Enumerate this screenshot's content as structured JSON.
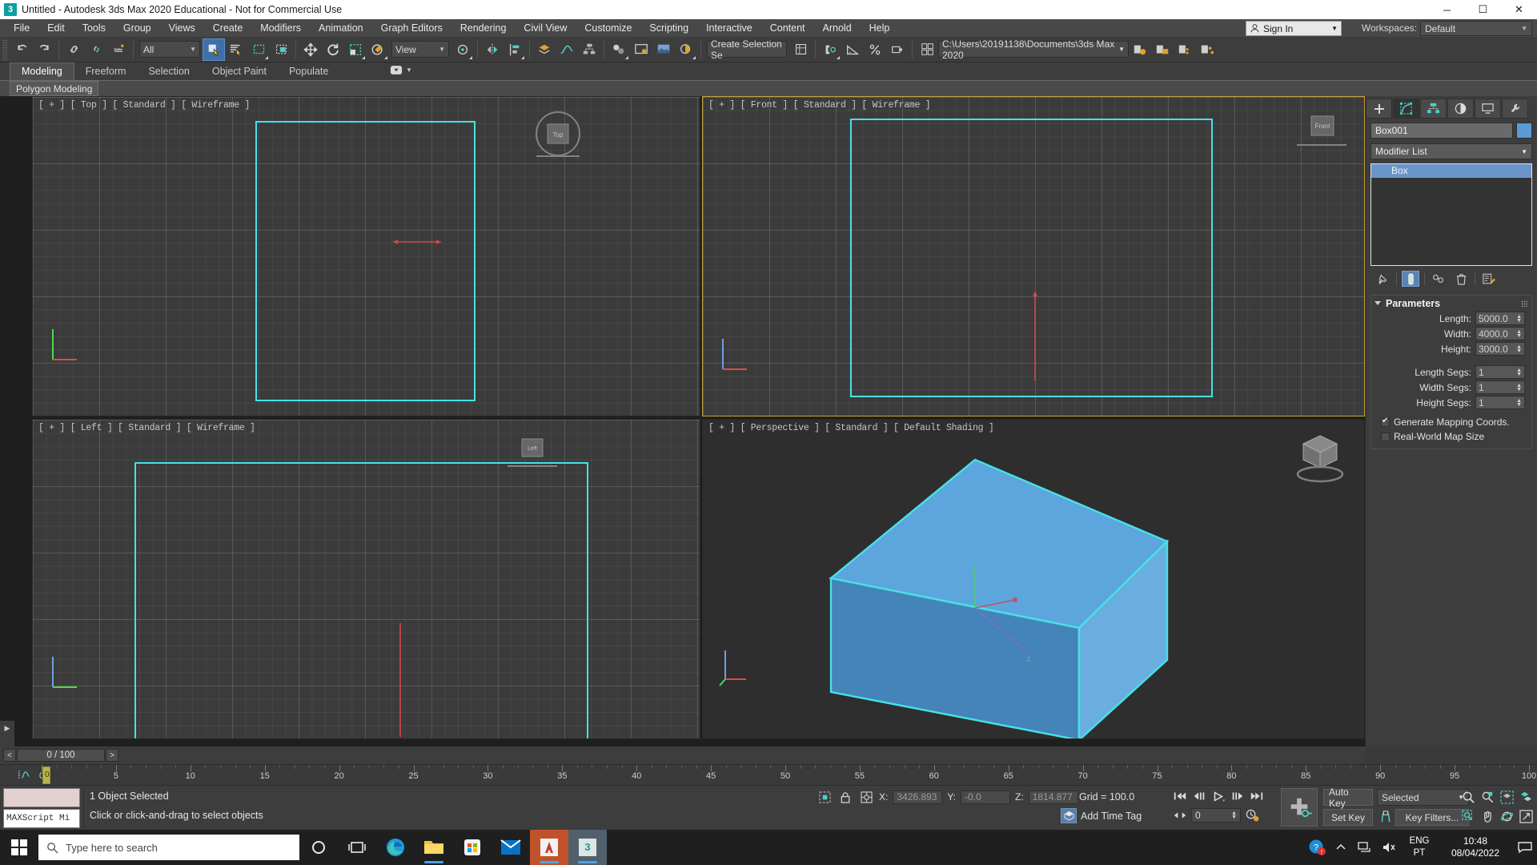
{
  "window": {
    "title": "Untitled - Autodesk 3ds Max 2020 Educational - Not for Commercial Use",
    "logo_text": "3",
    "minimize": "─",
    "maximize": "☐",
    "close": "✕"
  },
  "menu": {
    "items": [
      "File",
      "Edit",
      "Tools",
      "Group",
      "Views",
      "Create",
      "Modifiers",
      "Animation",
      "Graph Editors",
      "Rendering",
      "Civil View",
      "Customize",
      "Scripting",
      "Interactive",
      "Content",
      "Arnold",
      "Help"
    ],
    "sign_in": "Sign In",
    "workspaces_label": "Workspaces:",
    "workspace_value": "Default"
  },
  "toolbar": {
    "selection_filter": "All",
    "reference_coord": "View",
    "selection_set_placeholder": "Create Selection Se",
    "project_path": "C:\\Users\\20191138\\Documents\\3ds Max 2020"
  },
  "ribbon": {
    "tabs": [
      "Modeling",
      "Freeform",
      "Selection",
      "Object Paint",
      "Populate"
    ],
    "active_tab": "Modeling",
    "panel_title": "Polygon Modeling"
  },
  "viewports": [
    {
      "label": "[ + ] [ Top ] [ Standard ] [ Wireframe ]",
      "name": "top"
    },
    {
      "label": "[ + ] [ Front ] [ Standard ] [ Wireframe ]",
      "name": "front"
    },
    {
      "label": "[ + ] [ Left ] [ Standard ] [ Wireframe ]",
      "name": "left"
    },
    {
      "label": "[ + ] [ Perspective ] [ Standard ] [ Default Shading ]",
      "name": "perspective"
    }
  ],
  "viewcube": {
    "top": "Top",
    "front": "Front",
    "left": "Left"
  },
  "command_panel": {
    "tabs": [
      "create-tab",
      "modify-tab",
      "hierarchy-tab",
      "motion-tab",
      "display-tab",
      "utilities-tab"
    ],
    "active_tab_index": 1,
    "object_name": "Box001",
    "object_color": "#5b9bd5",
    "modifier_list_label": "Modifier List",
    "stack": [
      {
        "label": "Box",
        "selected": true
      }
    ],
    "rollout_title": "Parameters",
    "params": [
      {
        "label": "Length:",
        "value": "5000.0"
      },
      {
        "label": "Width:",
        "value": "4000.0"
      },
      {
        "label": "Height:",
        "value": "3000.0"
      }
    ],
    "segs": [
      {
        "label": "Length Segs:",
        "value": "1"
      },
      {
        "label": "Width Segs:",
        "value": "1"
      },
      {
        "label": "Height Segs:",
        "value": "1"
      }
    ],
    "checkboxes": [
      {
        "label": "Generate Mapping Coords.",
        "checked": true
      },
      {
        "label": "Real-World Map Size",
        "checked": false
      }
    ]
  },
  "timeline": {
    "prev_label": "<",
    "next_label": ">",
    "current": "0 / 100",
    "start": 0,
    "end": 100,
    "major_step": 5,
    "labels": [
      0,
      5,
      10,
      15,
      20,
      25,
      30,
      35,
      40,
      45,
      50,
      55,
      60,
      65,
      70,
      75,
      80,
      85,
      90,
      95,
      100
    ],
    "slider_frame": "0"
  },
  "status": {
    "maxscript_label": "MAXScript Mi",
    "selection_text": "1 Object Selected",
    "prompt_text": "Click or click-and-drag to select objects",
    "coords": [
      {
        "axis": "X:",
        "value": "3426.893"
      },
      {
        "axis": "Y:",
        "value": "-0.0"
      },
      {
        "axis": "Z:",
        "value": "1814.877"
      }
    ],
    "grid_text": "Grid = 100.0",
    "add_time_tag": "Add Time Tag",
    "frame_value": "0",
    "auto_key": "Auto Key",
    "set_key": "Set Key",
    "key_mode": "Selected",
    "key_filters": "Key Filters..."
  },
  "taskbar": {
    "search_placeholder": "Type here to search",
    "language": "ENG",
    "language_sub": "PT",
    "time": "10:48",
    "date": "08/04/2022"
  }
}
